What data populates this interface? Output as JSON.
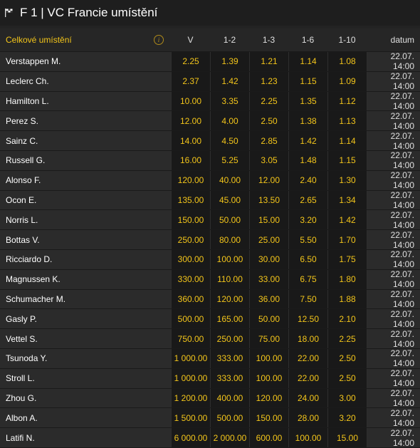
{
  "header": {
    "title": "F 1 | VC Francie umístění",
    "flag_icon": "checkered-flag-icon"
  },
  "table": {
    "title": "Celkové umístění",
    "info_icon": "info-icon",
    "columns": [
      "V",
      "1-2",
      "1-3",
      "1-6",
      "1-10",
      "datum"
    ],
    "rows": [
      {
        "name": "Verstappen M.",
        "odds": [
          "2.25",
          "1.39",
          "1.21",
          "1.14",
          "1.08"
        ],
        "date": "22.07. 14:00"
      },
      {
        "name": "Leclerc Ch.",
        "odds": [
          "2.37",
          "1.42",
          "1.23",
          "1.15",
          "1.09"
        ],
        "date": "22.07. 14:00"
      },
      {
        "name": "Hamilton L.",
        "odds": [
          "10.00",
          "3.35",
          "2.25",
          "1.35",
          "1.12"
        ],
        "date": "22.07. 14:00"
      },
      {
        "name": "Perez S.",
        "odds": [
          "12.00",
          "4.00",
          "2.50",
          "1.38",
          "1.13"
        ],
        "date": "22.07. 14:00"
      },
      {
        "name": "Sainz C.",
        "odds": [
          "14.00",
          "4.50",
          "2.85",
          "1.42",
          "1.14"
        ],
        "date": "22.07. 14:00"
      },
      {
        "name": "Russell G.",
        "odds": [
          "16.00",
          "5.25",
          "3.05",
          "1.48",
          "1.15"
        ],
        "date": "22.07. 14:00"
      },
      {
        "name": "Alonso F.",
        "odds": [
          "120.00",
          "40.00",
          "12.00",
          "2.40",
          "1.30"
        ],
        "date": "22.07. 14:00"
      },
      {
        "name": "Ocon E.",
        "odds": [
          "135.00",
          "45.00",
          "13.50",
          "2.65",
          "1.34"
        ],
        "date": "22.07. 14:00"
      },
      {
        "name": "Norris L.",
        "odds": [
          "150.00",
          "50.00",
          "15.00",
          "3.20",
          "1.42"
        ],
        "date": "22.07. 14:00"
      },
      {
        "name": "Bottas V.",
        "odds": [
          "250.00",
          "80.00",
          "25.00",
          "5.50",
          "1.70"
        ],
        "date": "22.07. 14:00"
      },
      {
        "name": "Ricciardo D.",
        "odds": [
          "300.00",
          "100.00",
          "30.00",
          "6.50",
          "1.75"
        ],
        "date": "22.07. 14:00"
      },
      {
        "name": "Magnussen K.",
        "odds": [
          "330.00",
          "110.00",
          "33.00",
          "6.75",
          "1.80"
        ],
        "date": "22.07. 14:00"
      },
      {
        "name": "Schumacher M.",
        "odds": [
          "360.00",
          "120.00",
          "36.00",
          "7.50",
          "1.88"
        ],
        "date": "22.07. 14:00"
      },
      {
        "name": "Gasly P.",
        "odds": [
          "500.00",
          "165.00",
          "50.00",
          "12.50",
          "2.10"
        ],
        "date": "22.07. 14:00"
      },
      {
        "name": "Vettel S.",
        "odds": [
          "750.00",
          "250.00",
          "75.00",
          "18.00",
          "2.25"
        ],
        "date": "22.07. 14:00"
      },
      {
        "name": "Tsunoda Y.",
        "odds": [
          "1 000.00",
          "333.00",
          "100.00",
          "22.00",
          "2.50"
        ],
        "date": "22.07. 14:00"
      },
      {
        "name": "Stroll L.",
        "odds": [
          "1 000.00",
          "333.00",
          "100.00",
          "22.00",
          "2.50"
        ],
        "date": "22.07. 14:00"
      },
      {
        "name": "Zhou G.",
        "odds": [
          "1 200.00",
          "400.00",
          "120.00",
          "24.00",
          "3.00"
        ],
        "date": "22.07. 14:00"
      },
      {
        "name": "Albon A.",
        "odds": [
          "1 500.00",
          "500.00",
          "150.00",
          "28.00",
          "3.20"
        ],
        "date": "22.07. 14:00"
      },
      {
        "name": "Latifi N.",
        "odds": [
          "6 000.00",
          "2 000.00",
          "600.00",
          "100.00",
          "15.00"
        ],
        "date": "22.07. 14:00"
      }
    ]
  },
  "colors": {
    "accent": "#f3c51a",
    "background": "#232323"
  }
}
